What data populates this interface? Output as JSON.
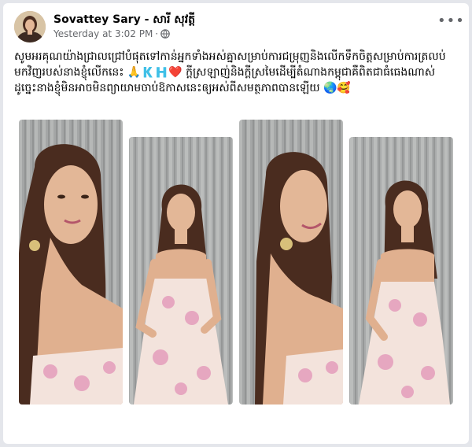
{
  "post": {
    "author": "Sovattey Sary - សារី សុវត្តី",
    "timestamp": "Yesterday at 3:02 PM",
    "separator": "·",
    "privacy_icon": "globe-icon",
    "more_label": "•••",
    "caption": "សូមអរគុណយ៉ាងជ្រាលជ្រៅបំផុតទៅកាន់អ្នកទាំងអស់គ្នាសម្រាប់ការជម្រុញនិងលើកទឹកចិត្តសម្រាប់ការត្រលប់មកវិញរបស់នាងខ្ញុំលើកនេះ 🙏🇰🇭❤️ ក្តីស្រឡាញ់និងក្តីស្រមៃដើម្បីតំណាងកម្ពុជាគឺពិតជាធំធេងណាស់ ដូច្នេះនាងខ្ញុំមិនអាចមិនព្យាយាមចាប់ឱកាសនេះឲ្យអស់ពីសមត្ថភាពបានឡើយ 🌏🥰"
  },
  "photos": [
    {
      "icon": "portrait-photo-1"
    },
    {
      "icon": "portrait-photo-2"
    },
    {
      "icon": "portrait-photo-3"
    },
    {
      "icon": "portrait-photo-4"
    }
  ],
  "colors": {
    "background": "#e4e6eb",
    "card": "#ffffff",
    "text": "#050505",
    "secondary": "#65676b",
    "curtain": "#a9abab",
    "dress_base": "#f3e3dc",
    "flower": "#e6a7c0",
    "hair": "#4a2c1f",
    "skin": "#e3b797"
  }
}
